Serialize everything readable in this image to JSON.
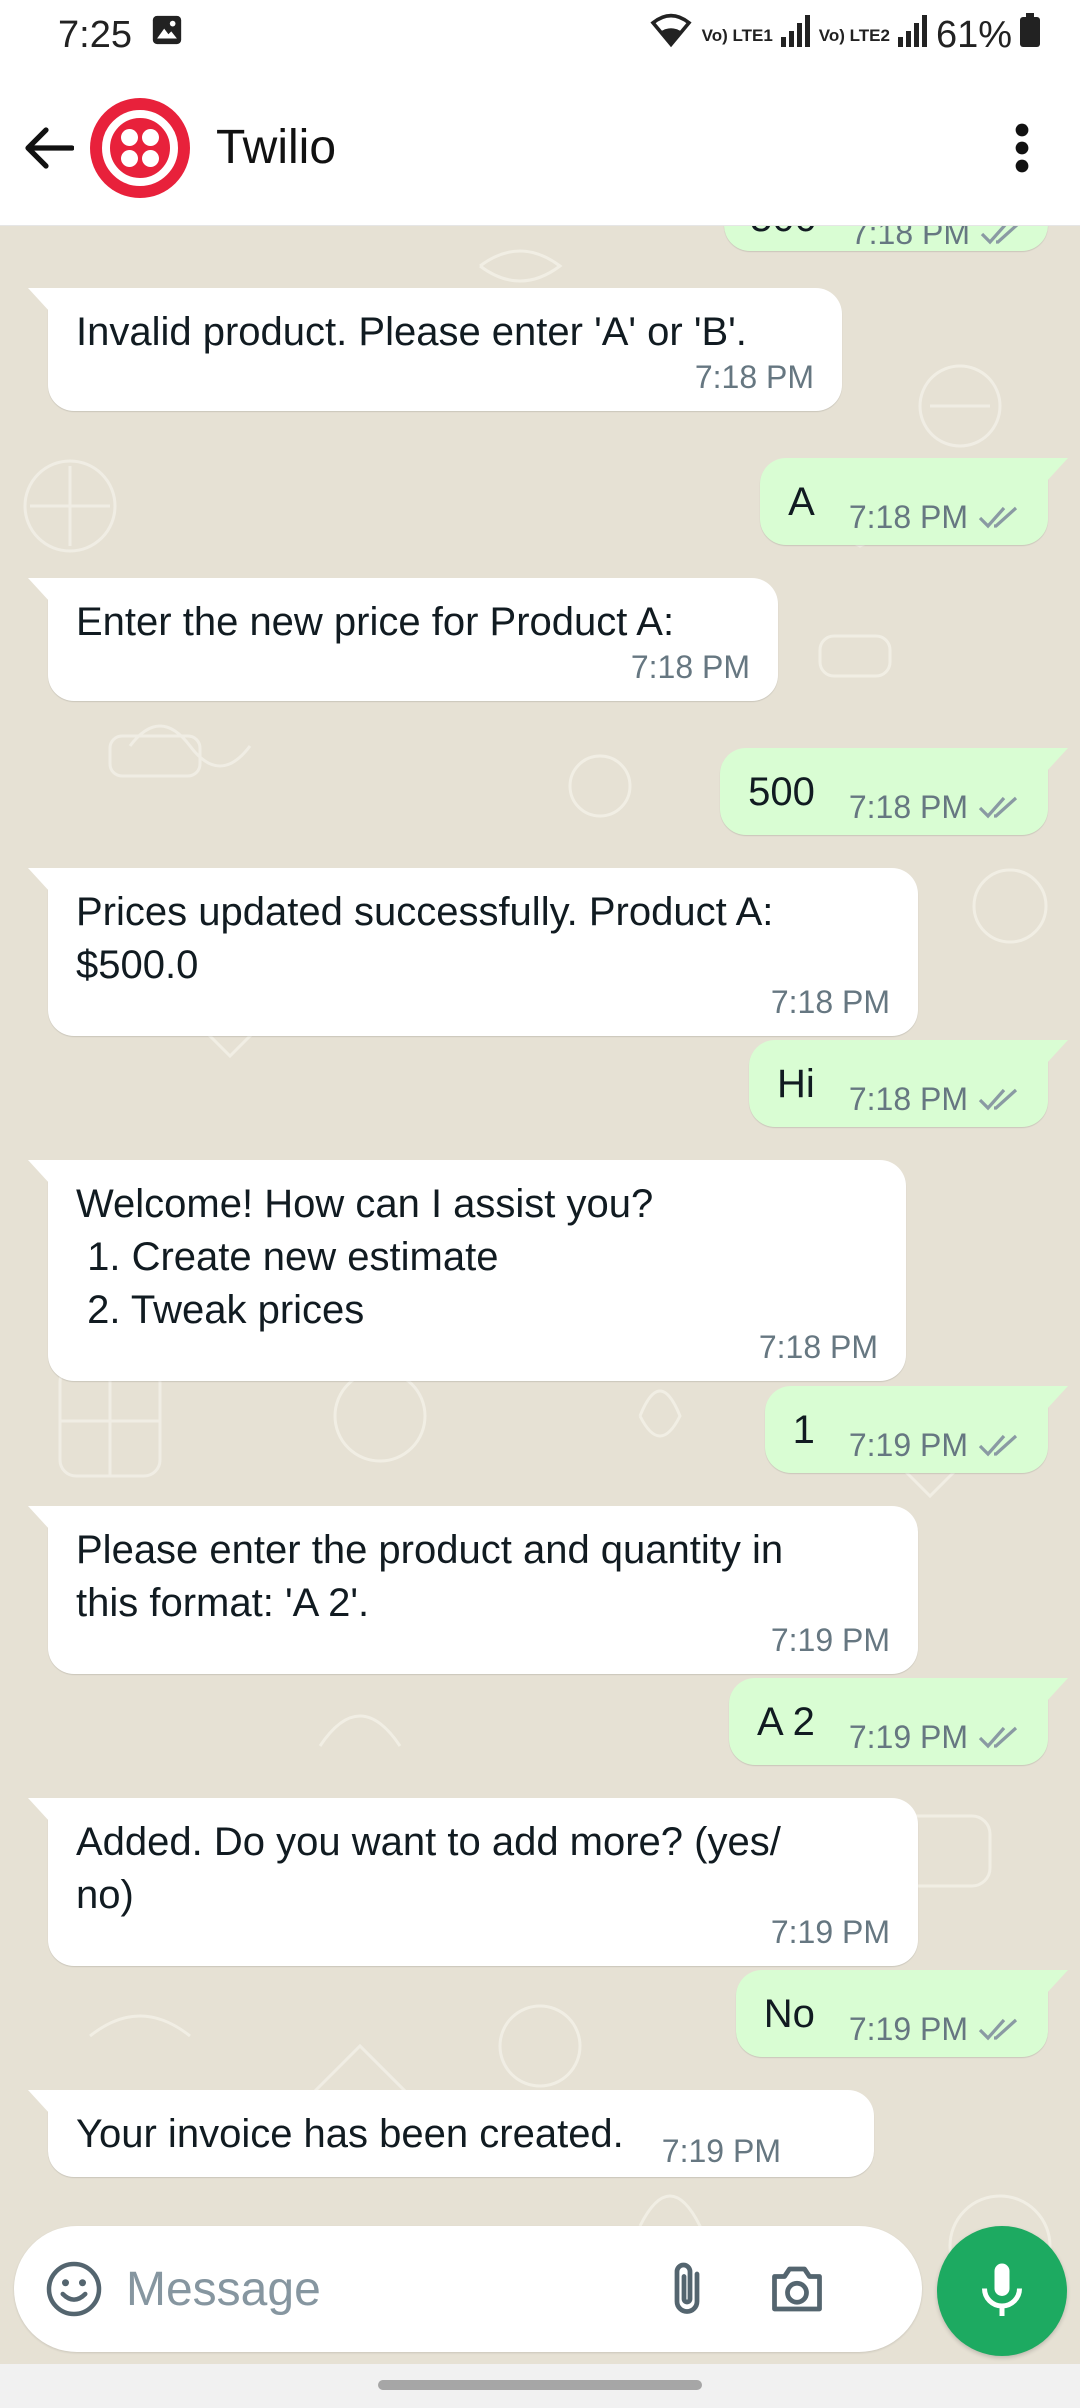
{
  "status_bar": {
    "time": "7:25",
    "sim1_label": "Vo) LTE1",
    "sim2_label": "Vo) LTE2",
    "battery": "61%"
  },
  "header": {
    "contact_name": "Twilio",
    "avatar_color": "#e8213b"
  },
  "messages": [
    {
      "direction": "out",
      "text": "500",
      "time": "7:18 PM",
      "partial": true
    },
    {
      "direction": "in",
      "text": "Invalid product. Please enter 'A' or 'B'.",
      "time": "7:18 PM"
    },
    {
      "direction": "out",
      "text": "A",
      "time": "7:18 PM"
    },
    {
      "direction": "in",
      "text": "Enter the new price for Product A:",
      "time": "7:18 PM"
    },
    {
      "direction": "out",
      "text": "500",
      "time": "7:18 PM"
    },
    {
      "direction": "in",
      "text": "Prices updated successfully. Product A:\n$500.0",
      "time": "7:18 PM"
    },
    {
      "direction": "out",
      "text": "Hi",
      "time": "7:18 PM"
    },
    {
      "direction": "in",
      "text": "Welcome! How can I assist you?\n 1. Create new estimate\n 2. Tweak prices",
      "time": "7:18 PM"
    },
    {
      "direction": "out",
      "text": "1",
      "time": "7:19 PM"
    },
    {
      "direction": "in",
      "text": "Please enter the product and quantity in\nthis format: 'A 2'.",
      "time": "7:19 PM"
    },
    {
      "direction": "out",
      "text": "A 2",
      "time": "7:19 PM"
    },
    {
      "direction": "in",
      "text": "Added. Do you want to add more? (yes/\nno)",
      "time": "7:19 PM"
    },
    {
      "direction": "out",
      "text": "No",
      "time": "7:19 PM"
    },
    {
      "direction": "in",
      "text": "Your invoice has been created.",
      "time": "7:19 PM"
    }
  ],
  "composer": {
    "placeholder": "Message"
  },
  "colors": {
    "outgoing_bubble": "#d9fdd3",
    "incoming_bubble": "#ffffff",
    "chat_background": "#e6e1d4",
    "read_ticks": "#8a9aa3",
    "mic_button": "#1daa61"
  },
  "icons": [
    "back-arrow-icon",
    "twilio-logo-icon",
    "more-vert-icon",
    "emoji-icon",
    "attach-icon",
    "camera-icon",
    "mic-icon",
    "double-check-icon",
    "gallery-icon",
    "wifi-icon",
    "signal-icon",
    "battery-icon"
  ]
}
